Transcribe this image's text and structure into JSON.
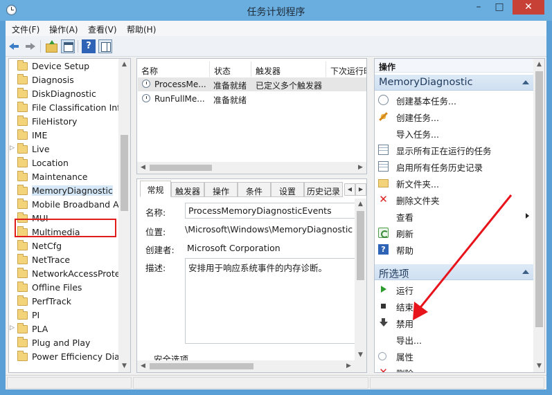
{
  "window": {
    "title": "任务计划程序",
    "minimize": "–",
    "maximize": "□",
    "close": "✕"
  },
  "menu": [
    "文件(F)",
    "操作(A)",
    "查看(V)",
    "帮助(H)"
  ],
  "toolbar": {
    "help_label": "?"
  },
  "tree": {
    "selected": "MemoryDiagnostic",
    "items": [
      {
        "label": "Device Setup",
        "expandable": false
      },
      {
        "label": "Diagnosis",
        "expandable": false
      },
      {
        "label": "DiskDiagnostic",
        "expandable": false
      },
      {
        "label": "File Classification Infr",
        "expandable": false
      },
      {
        "label": "FileHistory",
        "expandable": false
      },
      {
        "label": "IME",
        "expandable": false
      },
      {
        "label": "Live",
        "expandable": true
      },
      {
        "label": "Location",
        "expandable": false
      },
      {
        "label": "Maintenance",
        "expandable": false
      },
      {
        "label": "MemoryDiagnostic",
        "expandable": false
      },
      {
        "label": "Mobile Broadband A",
        "expandable": false
      },
      {
        "label": "MUI",
        "expandable": false
      },
      {
        "label": "Multimedia",
        "expandable": false
      },
      {
        "label": "NetCfg",
        "expandable": false
      },
      {
        "label": "NetTrace",
        "expandable": false
      },
      {
        "label": "NetworkAccessProte",
        "expandable": false
      },
      {
        "label": "Offline Files",
        "expandable": false
      },
      {
        "label": "PerfTrack",
        "expandable": false
      },
      {
        "label": "PI",
        "expandable": false
      },
      {
        "label": "PLA",
        "expandable": true
      },
      {
        "label": "Plug and Play",
        "expandable": false
      },
      {
        "label": "Power Efficiency Diag",
        "expandable": false
      }
    ]
  },
  "tasklist": {
    "columns": [
      "名称",
      "状态",
      "触发器",
      "下次运行时"
    ],
    "rows": [
      {
        "name": "ProcessMe...",
        "status": "准备就绪",
        "trigger": "已定义多个触发器",
        "next": ""
      },
      {
        "name": "RunFullMe...",
        "status": "准备就绪",
        "trigger": "",
        "next": ""
      }
    ]
  },
  "details": {
    "tabs": [
      "常规",
      "触发器",
      "操作",
      "条件",
      "设置",
      "历史记录"
    ],
    "name_label": "名称:",
    "name_value": "ProcessMemoryDiagnosticEvents",
    "location_label": "位置:",
    "location_value": "\\Microsoft\\Windows\\MemoryDiagnostic",
    "author_label": "创建者:",
    "author_value": "Microsoft Corporation",
    "desc_label": "描述:",
    "desc_value": "安排用于响应系统事件的内存诊断。",
    "security_label": "安全选项"
  },
  "actions": {
    "header": "操作",
    "section1": {
      "title": "MemoryDiagnostic",
      "items": [
        {
          "icon": "task-icon",
          "label": "创建基本任务..."
        },
        {
          "icon": "create-task-icon",
          "label": "创建任务..."
        },
        {
          "icon": "",
          "label": "导入任务..."
        },
        {
          "icon": "list-icon",
          "label": "显示所有正在运行的任务"
        },
        {
          "icon": "history-icon",
          "label": "启用所有任务历史记录"
        },
        {
          "icon": "folder-icon",
          "label": "新文件夹..."
        },
        {
          "icon": "delete-x-icon",
          "label": "删除文件夹"
        },
        {
          "icon": "",
          "label": "查看",
          "submenu": true
        },
        {
          "icon": "refresh-icon",
          "label": "刷新"
        },
        {
          "icon": "help-icon",
          "label": "帮助"
        }
      ]
    },
    "section2": {
      "title": "所选项",
      "items": [
        {
          "icon": "run-icon",
          "label": "运行"
        },
        {
          "icon": "stop-icon",
          "label": "结束"
        },
        {
          "icon": "disable-icon",
          "label": "禁用"
        },
        {
          "icon": "",
          "label": "导出..."
        },
        {
          "icon": "properties-icon",
          "label": "属性"
        },
        {
          "icon": "delete-icon",
          "label": "删除"
        }
      ]
    }
  },
  "colors": {
    "highlight_box": "#e21b1b",
    "arrow": "#e8141c",
    "titlebar": "#6aaee0"
  }
}
